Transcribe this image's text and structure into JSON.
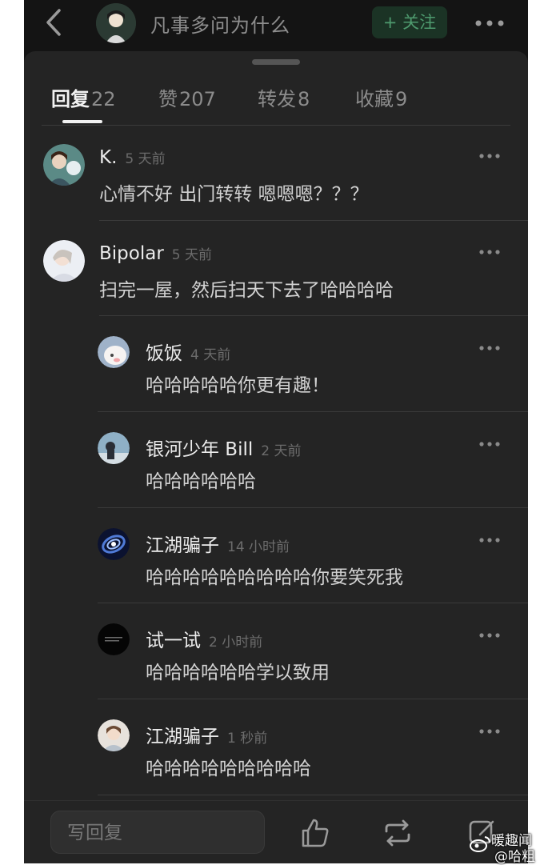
{
  "header": {
    "title": "凡事多问为什么",
    "follow_label": "+ 关注",
    "icons": {
      "back": "back-chevron-icon",
      "more": "more-dots-icon"
    }
  },
  "tabs": [
    {
      "name": "回复",
      "count": "22",
      "active": true
    },
    {
      "name": "赞",
      "count": "207",
      "active": false
    },
    {
      "name": "转发",
      "count": "8",
      "active": false
    },
    {
      "name": "收藏",
      "count": "9",
      "active": false
    }
  ],
  "comments": [
    {
      "name": "K.",
      "time": "5 天前",
      "text": "心情不好   出门转转   嗯嗯嗯？？？",
      "reply": false
    },
    {
      "name": "Bipolar",
      "time": "5 天前",
      "text": "扫完一屋，然后扫天下去了哈哈哈哈",
      "reply": false
    },
    {
      "name": "饭饭",
      "time": "4 天前",
      "text": "哈哈哈哈哈你更有趣！",
      "reply": true
    },
    {
      "name": "银河少年 Bill",
      "time": "2 天前",
      "text": "哈哈哈哈哈哈",
      "reply": true
    },
    {
      "name": "江湖骗子",
      "time": "14 小时前",
      "text": "哈哈哈哈哈哈哈哈哈你要笑死我",
      "reply": true
    },
    {
      "name": "试一试",
      "time": "2 小时前",
      "text": "哈哈哈哈哈哈学以致用",
      "reply": true
    },
    {
      "name": "江湖骗子",
      "time": "1 秒前",
      "text": "哈哈哈哈哈哈哈哈哈",
      "reply": true
    }
  ],
  "bottom": {
    "reply_placeholder": "写回复",
    "icons": [
      "like-icon",
      "repost-icon",
      "share-icon"
    ]
  },
  "watermark": {
    "line1": "暖趣闻",
    "line2": "@哈粗"
  },
  "colors": {
    "background": "#141414",
    "sheet": "#242424",
    "follow_bg": "#1b3325",
    "follow_text": "#4e9a6e"
  }
}
